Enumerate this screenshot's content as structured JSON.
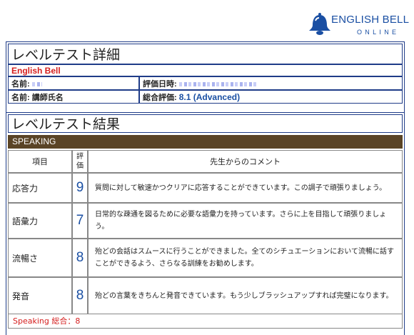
{
  "logo": {
    "line1": "ENGLISH BELL",
    "line2": "ONLINE",
    "color": "#1a4fa3"
  },
  "details": {
    "title": "レベルテスト詳細",
    "brand": "English Bell",
    "name_label": "名前:",
    "date_label": "評価日時:",
    "teacher_label": "名前: 講師氏名",
    "overall_label": "総合評価:",
    "overall_value": "8.1 (Advanced)"
  },
  "results": {
    "title": "レベルテスト結果",
    "section": "SPEAKING",
    "headers": {
      "item": "項目",
      "rating": "評価",
      "comment": "先生からのコメント"
    },
    "rows": [
      {
        "item": "応答力",
        "score": "9",
        "comment": "質問に対して敏速かつクリアに応答することができています。この調子で頑張りましょう。"
      },
      {
        "item": "語彙力",
        "score": "7",
        "comment": "日常的な疎通を図るために必要な語彙力を持っています。さらに上を目指して頑張りましょう。"
      },
      {
        "item": "流暢さ",
        "score": "8",
        "comment": "殆どの会話はスムースに行うことができました。全てのシチュエーションにおいて流暢に話すことができるよう、さらなる訓練をお勧めします。"
      },
      {
        "item": "発音",
        "score": "8",
        "comment": "殆どの言葉をきちんと発音できています。もう少しブラッシュアップすれば完璧になります。"
      }
    ],
    "total": "Speaking 総合：8"
  },
  "colors": {
    "border": "#1f3c88",
    "brand_red": "#d51e1e",
    "section_bar": "#5a4426"
  }
}
